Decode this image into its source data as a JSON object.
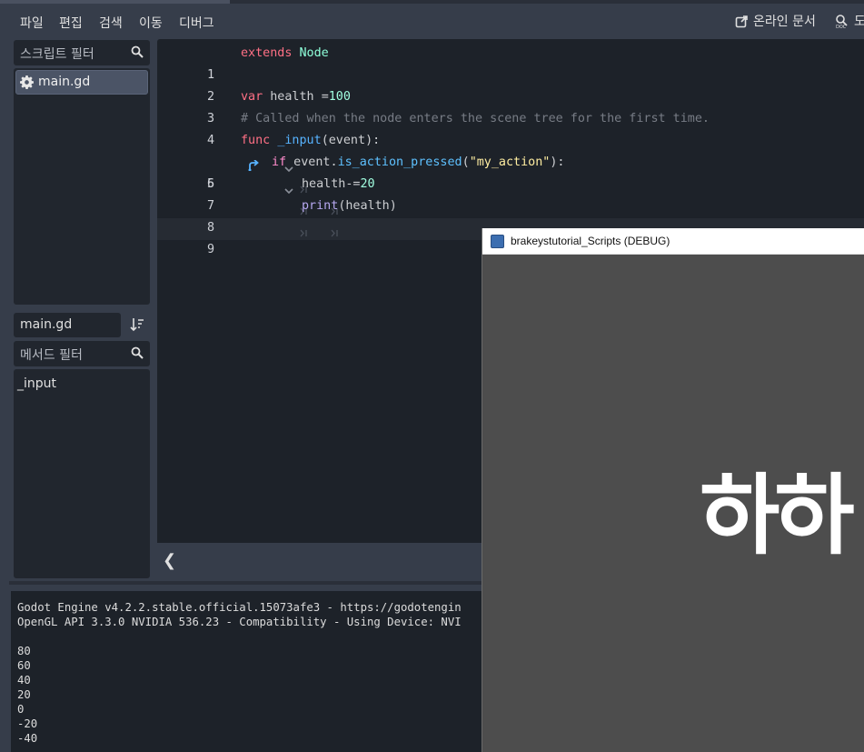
{
  "menu": {
    "items": [
      "파일",
      "편집",
      "검색",
      "이동",
      "디버그"
    ],
    "online_docs": "온라인 문서",
    "doc_cut": "도"
  },
  "script_panel": {
    "filter_placeholder": "스크립트 필터",
    "scripts": [
      "main.gd"
    ],
    "current_script": "main.gd",
    "method_filter_placeholder": "메서드 필터",
    "methods": [
      "_input"
    ]
  },
  "editor": {
    "line_numbers": [
      "1",
      "2",
      "3",
      "4",
      "5",
      "6",
      "7",
      "8",
      "9"
    ],
    "line1": {
      "kw": "extends",
      "cls": "Node"
    },
    "line3": {
      "kw": "var",
      "name": " health ",
      "op": "=",
      "num": "100"
    },
    "line4": {
      "comment": "# Called when the node enters the scene tree for the first time."
    },
    "line5": {
      "kw": "func",
      "fn": "_input",
      "open": "(",
      "arg": "event",
      "close": "):"
    },
    "line6": {
      "kw": "if",
      "obj": " event.",
      "fn": "is_action_pressed",
      "open": "(",
      "str": "\"my_action\"",
      "close": "):"
    },
    "line7": {
      "name": "health-=",
      "num": "20"
    },
    "line8": {
      "fn": "print",
      "args": "(health)"
    }
  },
  "output": {
    "lines": [
      "Godot Engine v4.2.2.stable.official.15073afe3 - https://godotengin",
      "OpenGL API 3.3.0 NVIDIA 536.23 - Compatibility - Using Device: NVI",
      "",
      "80",
      "60",
      "40",
      "20",
      "0",
      "-20",
      "-40"
    ]
  },
  "game_window": {
    "title": "brakeystutorial_Scripts (DEBUG)",
    "big_text": "하하"
  },
  "colors": {
    "background": "#363d4a",
    "editor_bg": "#1d2229",
    "keyword": "#ff7085",
    "class": "#8effda",
    "number": "#a1ffe0",
    "function": "#57b3ff",
    "string": "#ffeda1",
    "comment": "#777c85"
  }
}
